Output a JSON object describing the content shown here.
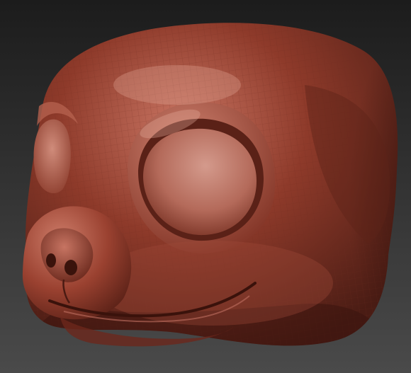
{
  "viewport": {
    "subject": "sculpted-creature-head",
    "colors": {
      "background_top": "#1c1c1c",
      "background_bottom": "#4a4a4a",
      "clay_base": "#8e3a2a",
      "clay_highlight": "#c97563",
      "clay_shadow": "#4a1c14",
      "clay_deep": "#2e0f0a",
      "wire": "#6f2c20"
    }
  }
}
